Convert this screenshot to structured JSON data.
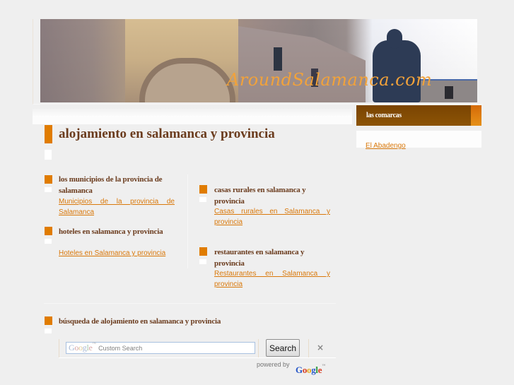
{
  "header": {
    "site_name": "AroundSalamanca.com",
    "banner_alt": "Salamanca university facade with statue"
  },
  "main": {
    "title": "alojamiento en salamanca y provincia",
    "sections": [
      {
        "title": "los municipios de la provincia de salamanca",
        "link": "Municipios de la provincia de Salamanca"
      },
      {
        "title": "hoteles en salamanca y provincia",
        "link": "Hoteles en Salamanca y provincia"
      },
      {
        "title": "casas rurales en salamanca y provincia",
        "link": "Casas rurales en Salamanca y provincia"
      },
      {
        "title": "restaurantes en salamanca y provincia",
        "link": "Restaurantes en Salamanca y provincia"
      }
    ],
    "search_section": {
      "title": "búsqueda de alojamiento en salamanca y provincia",
      "input_logo": [
        "G",
        "o",
        "o",
        "g",
        "l",
        "e"
      ],
      "input_logo_tm": "™",
      "placeholder": "Custom Search",
      "value": "",
      "button_label": "Search",
      "clear_icon": "×",
      "powered_by": "powered by",
      "powered_logo": [
        "G",
        "o",
        "o",
        "g",
        "l",
        "e"
      ],
      "powered_logo_tm": "™"
    }
  },
  "sidebar": {
    "title": "las comarcas",
    "items": [
      {
        "label": "El Abadengo"
      }
    ]
  },
  "colors": {
    "accent_orange": "#e07c00",
    "heading_brown": "#6b3c1e",
    "link_orange": "#d9780a",
    "sidebar_header": "#7a4402",
    "background": "#efefef"
  }
}
